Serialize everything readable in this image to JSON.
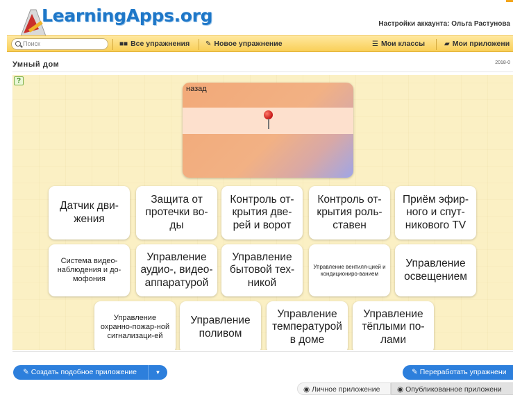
{
  "header": {
    "logo_text": "LearningApps.org",
    "account_label": "Настройки аккаунта: ",
    "account_name": "Ольга Растунова"
  },
  "nav": {
    "search_placeholder": "Поиск",
    "all_exercises": "Все упражнения",
    "new_exercise": "Новое упражнение",
    "my_classes": "Мои классы",
    "my_apps": "Мои приложени"
  },
  "page": {
    "title": "Умный дом",
    "date": "2018-0"
  },
  "app": {
    "help_icon": "?",
    "map_back_label": "назад",
    "cards": [
      "Датчик дви-жения",
      "Защита от протечки во-ды",
      "Контроль от-крытия две-рей и ворот",
      "Контроль от-крытия роль-ставен",
      "Приём эфир-ного и спут-никового TV",
      "Система видео-наблюдения и до-мофония",
      "Управление аудио-, видео-аппаратурой",
      "Управление бытовой тех-никой",
      "Управление вентиля-цией и кондициониро-ванием",
      "Управление освещением",
      "Управление охранно-пожар-ной сигнализаци-ей",
      "Управление поливом",
      "Управление температурой в доме",
      "Управление тёплыми по-лами"
    ]
  },
  "footer": {
    "create_similar": "Создать подобное приложение",
    "rework": "Переработать упражнени",
    "personal_app": "Личное приложение",
    "published_app": "Опубликованное приложени"
  },
  "colors": {
    "accent_blue": "#2d7fdc",
    "nav_yellow": "#f9cf57",
    "canvas": "#fbf0c4"
  }
}
